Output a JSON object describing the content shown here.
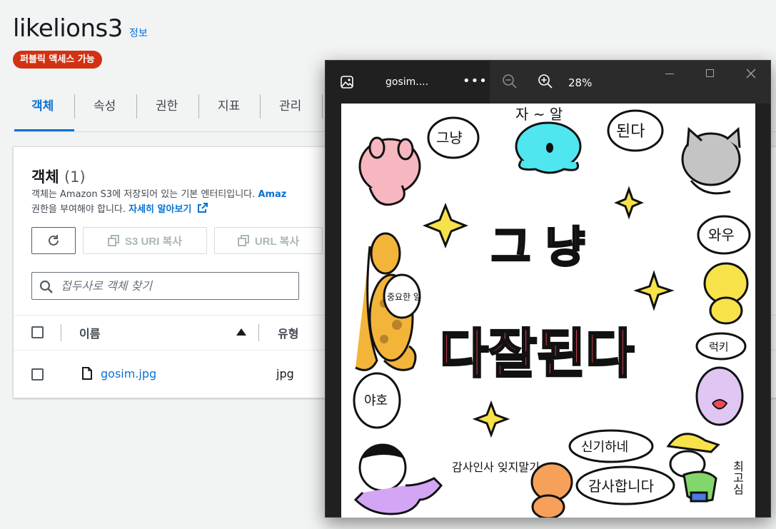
{
  "bucket": {
    "name": "likelions3",
    "info_label": "정보",
    "access_badge": "퍼블릭 액세스 가능"
  },
  "tabs": [
    {
      "label": "객체",
      "active": true
    },
    {
      "label": "속성",
      "active": false
    },
    {
      "label": "권한",
      "active": false
    },
    {
      "label": "지표",
      "active": false
    },
    {
      "label": "관리",
      "active": false
    }
  ],
  "objects_panel": {
    "title": "객체",
    "count": "(1)",
    "description": "객체는 Amazon S3에 저장되어 있는 기본 엔터티입니다.",
    "description_link_fragment": "Amaz",
    "description_line2": "권한을 부여해야 합니다.",
    "learn_more": "자세히 알아보기",
    "buttons": {
      "copy_s3_uri": "S3 URI 복사",
      "copy_url": "URL 복사"
    },
    "search_placeholder": "접두사로 객체 찾기",
    "columns": {
      "name": "이름",
      "type": "유형"
    },
    "rows": [
      {
        "name": "gosim.jpg",
        "type": "jpg"
      }
    ]
  },
  "viewer": {
    "file_name": "gosim....",
    "more_label": "•••",
    "zoom": "28%",
    "image": {
      "headline_line1": "그 냥",
      "headline_line2": "다잘된다",
      "bubbles": [
        "그냥",
        "된다",
        "와우",
        "야호",
        "최고심",
        "신기하네",
        "감사합니다",
        "럭키",
        "중요한 일"
      ],
      "labels": [
        "자 ~ 알",
        "감사인사 잊지말기"
      ]
    }
  },
  "colors": {
    "aws_blue": "#0972d3",
    "badge_red": "#d13212",
    "viewer_bg": "#202020"
  }
}
